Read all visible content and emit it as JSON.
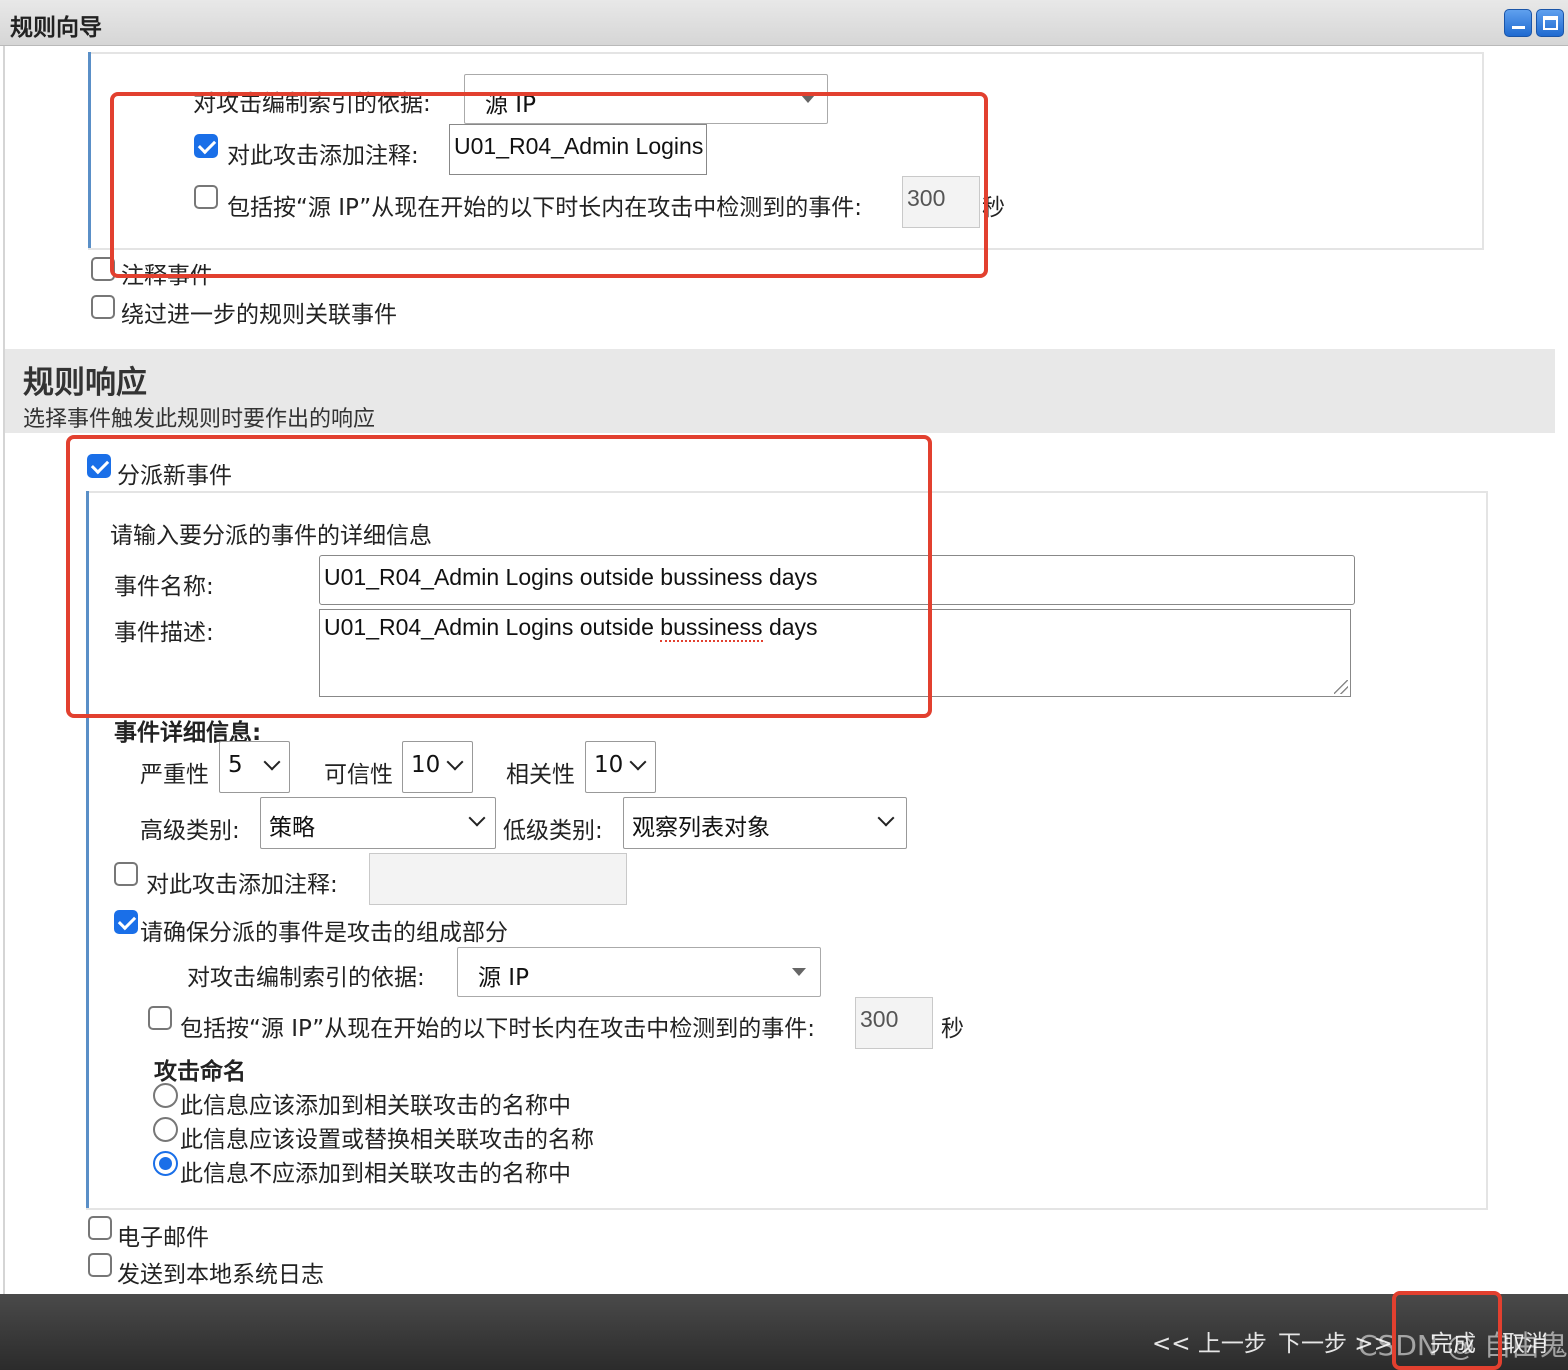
{
  "window": {
    "title": "规则向导"
  },
  "top_panel": {
    "index_label": "对攻击编制索引的依据:",
    "index_value": "源 IP",
    "annotate_checkbox_label": "对此攻击添加注释:",
    "annotate_checked": true,
    "annotate_value": "U01_R04_Admin Logins",
    "include_label": "包括按“源 IP”从现在开始的以下时长内在攻击中检测到的事件:",
    "include_checked": false,
    "include_value": "300",
    "seconds_label": "秒"
  },
  "options_top": [
    {
      "label": "注释事件",
      "checked": false
    },
    {
      "label": "绕过进一步的规则关联事件",
      "checked": false
    }
  ],
  "rule_response": {
    "heading": "规则响应",
    "subtitle": "选择事件触发此规则时要作出的响应"
  },
  "dispatch": {
    "checkbox_label": "分派新事件",
    "checked": true,
    "intro": "请输入要分派的事件的详细信息",
    "name_label": "事件名称:",
    "name_value": "U01_R04_Admin Logins outside bussiness days",
    "desc_label": "事件描述:",
    "desc_value_prefix": "U01_R04_Admin Logins outside ",
    "desc_value_misspelled": "bussiness",
    "desc_value_suffix": " days",
    "details_label": "事件详细信息:",
    "severity_label": "严重性",
    "severity_value": "5",
    "credibility_label": "可信性",
    "credibility_value": "10",
    "relevance_label": "相关性",
    "relevance_value": "10",
    "high_cat_label": "高级类别:",
    "high_cat_value": "策略",
    "low_cat_label": "低级类别:",
    "low_cat_value": "观察列表对象",
    "annotate_label": "对此攻击添加注释:",
    "annotate_checked": false,
    "annotate_value": "",
    "ensure_label": "请确保分派的事件是攻击的组成部分",
    "ensure_checked": true,
    "index_label": "对攻击编制索引的依据:",
    "index_value": "源 IP",
    "include_label": "包括按“源 IP”从现在开始的以下时长内在攻击中检测到的事件:",
    "include_checked": false,
    "include_value": "300",
    "seconds_label": "秒",
    "naming_heading": "攻击命名",
    "naming_options": [
      {
        "label": "此信息应该添加到相关联攻击的名称中",
        "checked": false
      },
      {
        "label": "此信息应该设置或替换相关联攻击的名称",
        "checked": false
      },
      {
        "label": "此信息不应添加到相关联攻击的名称中",
        "checked": true
      }
    ]
  },
  "options_bottom": [
    {
      "label": "电子邮件",
      "checked": false
    },
    {
      "label": "发送到本地系统日志",
      "checked": false
    }
  ],
  "footer": {
    "back_label": "<< 上一步",
    "next_label": "下一步 >>",
    "finish_label": "完成",
    "cancel_label": "取消",
    "watermark": "CSDN @ 自由鬼"
  },
  "colors": {
    "highlight": "#e2402f",
    "accent": "#1a6fe8"
  }
}
